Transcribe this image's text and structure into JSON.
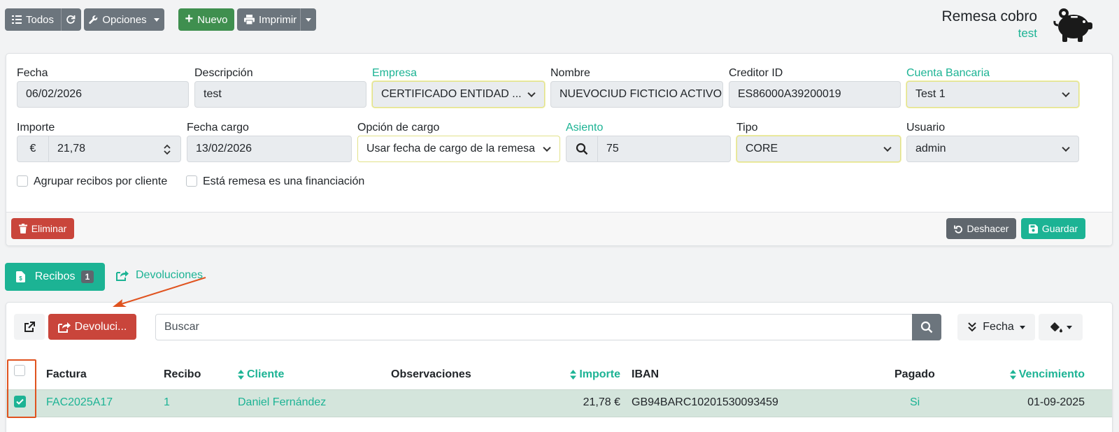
{
  "toolbar": {
    "todos": "Todos",
    "opciones": "Opciones",
    "nuevo": "Nuevo",
    "imprimir": "Imprimir"
  },
  "header": {
    "title": "Remesa cobro",
    "subtitle": "test"
  },
  "form": {
    "fecha": {
      "label": "Fecha",
      "value": "06/02/2026"
    },
    "descripcion": {
      "label": "Descripción",
      "value": "test"
    },
    "empresa": {
      "label": "Empresa",
      "value": "CERTIFICADO ENTIDAD ..."
    },
    "nombre": {
      "label": "Nombre",
      "value": "NUEVOCIUD FICTICIO ACTIVO"
    },
    "creditor": {
      "label": "Creditor ID",
      "value": "ES86000A39200019"
    },
    "cuenta": {
      "label": "Cuenta Bancaria",
      "value": "Test 1"
    },
    "importe": {
      "label": "Importe",
      "currency": "€",
      "value": "21,78"
    },
    "fecha_cargo": {
      "label": "Fecha cargo",
      "value": "13/02/2026"
    },
    "opcion_cargo": {
      "label": "Opción de cargo",
      "value": "Usar fecha de cargo de la remesa"
    },
    "asiento": {
      "label": "Asiento",
      "value": "75"
    },
    "tipo": {
      "label": "Tipo",
      "value": "CORE"
    },
    "usuario": {
      "label": "Usuario",
      "value": "admin"
    },
    "agrupar": "Agrupar recibos por cliente",
    "financiacion": "Está remesa es una financiación"
  },
  "actions": {
    "eliminar": "Eliminar",
    "deshacer": "Deshacer",
    "guardar": "Guardar"
  },
  "tabs": {
    "recibos": "Recibos",
    "recibos_count": "1",
    "devoluciones": "Devoluciones"
  },
  "list": {
    "devolucion_button": "Devoluci...",
    "search_placeholder": "Buscar",
    "sort_label": "Fecha",
    "columns": [
      "Factura",
      "Recibo",
      "Cliente",
      "Observaciones",
      "Importe",
      "IBAN",
      "Pagado",
      "Vencimiento"
    ],
    "rows": [
      {
        "factura": "FAC2025A17",
        "recibo": "1",
        "cliente": "Daniel Fernández",
        "observaciones": "",
        "importe": "21,78 €",
        "iban": "GB94BARC10201530093459",
        "pagado": "Si",
        "vencimiento": "01-09-2025"
      }
    ]
  },
  "colors": {
    "accent": "#1cb394",
    "danger": "#c9453b",
    "success": "#3f8f4f",
    "secondary": "#6c757d",
    "row_selected": "#d4e5dc",
    "annotation": "#e0531f"
  }
}
